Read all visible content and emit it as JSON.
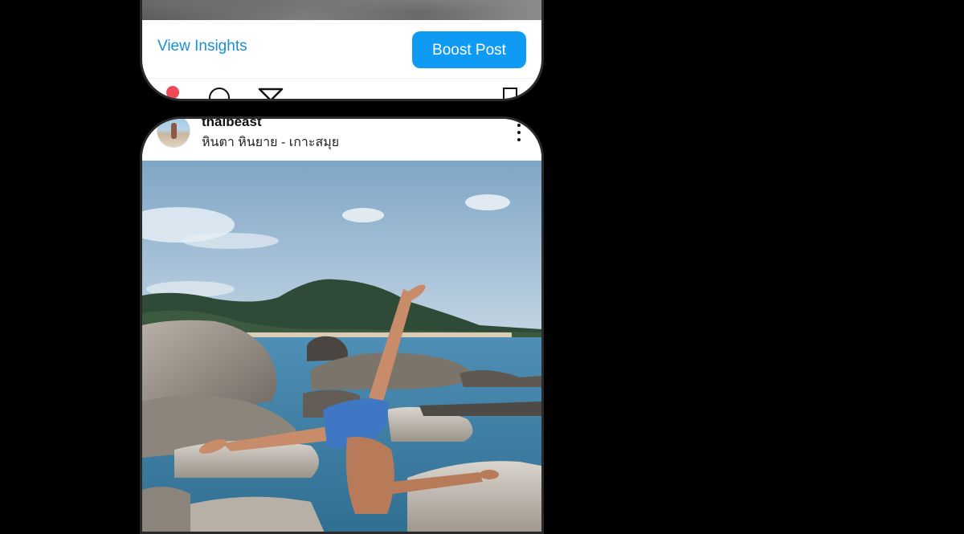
{
  "previous_post": {
    "view_insights_label": "View Insights",
    "boost_post_label": "Boost Post",
    "accent_color": "#0f9af4",
    "icons": [
      "heart-icon",
      "comment-icon",
      "share-icon",
      "save-icon"
    ]
  },
  "post": {
    "username": "thaibeast",
    "location": "หินตา หินยาย - เกาะสมุย",
    "icons": [
      "avatar",
      "more-options-icon"
    ],
    "media_description_icon": "beach-photo"
  }
}
